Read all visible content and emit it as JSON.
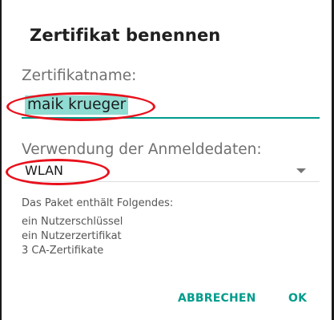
{
  "dialog": {
    "title": "Zertifikat benennen",
    "name_field": {
      "label": "Zertifikatname:",
      "value": "maik krueger"
    },
    "usage_field": {
      "label": "Verwendung der Anmeldedaten:",
      "selected": "WLAN"
    },
    "package": {
      "title": "Das Paket enthält Folgendes:",
      "items": [
        "ein Nutzerschlüssel",
        "ein Nutzerzertifikat",
        "3 CA-Zertifikate"
      ]
    },
    "buttons": {
      "cancel": "ABBRECHEN",
      "ok": "OK"
    }
  },
  "colors": {
    "accent": "#009c8c",
    "selection_highlight": "#8fdcd2",
    "annotation": "#e8101c"
  },
  "icons": {
    "dropdown": "dropdown-arrow-icon"
  }
}
